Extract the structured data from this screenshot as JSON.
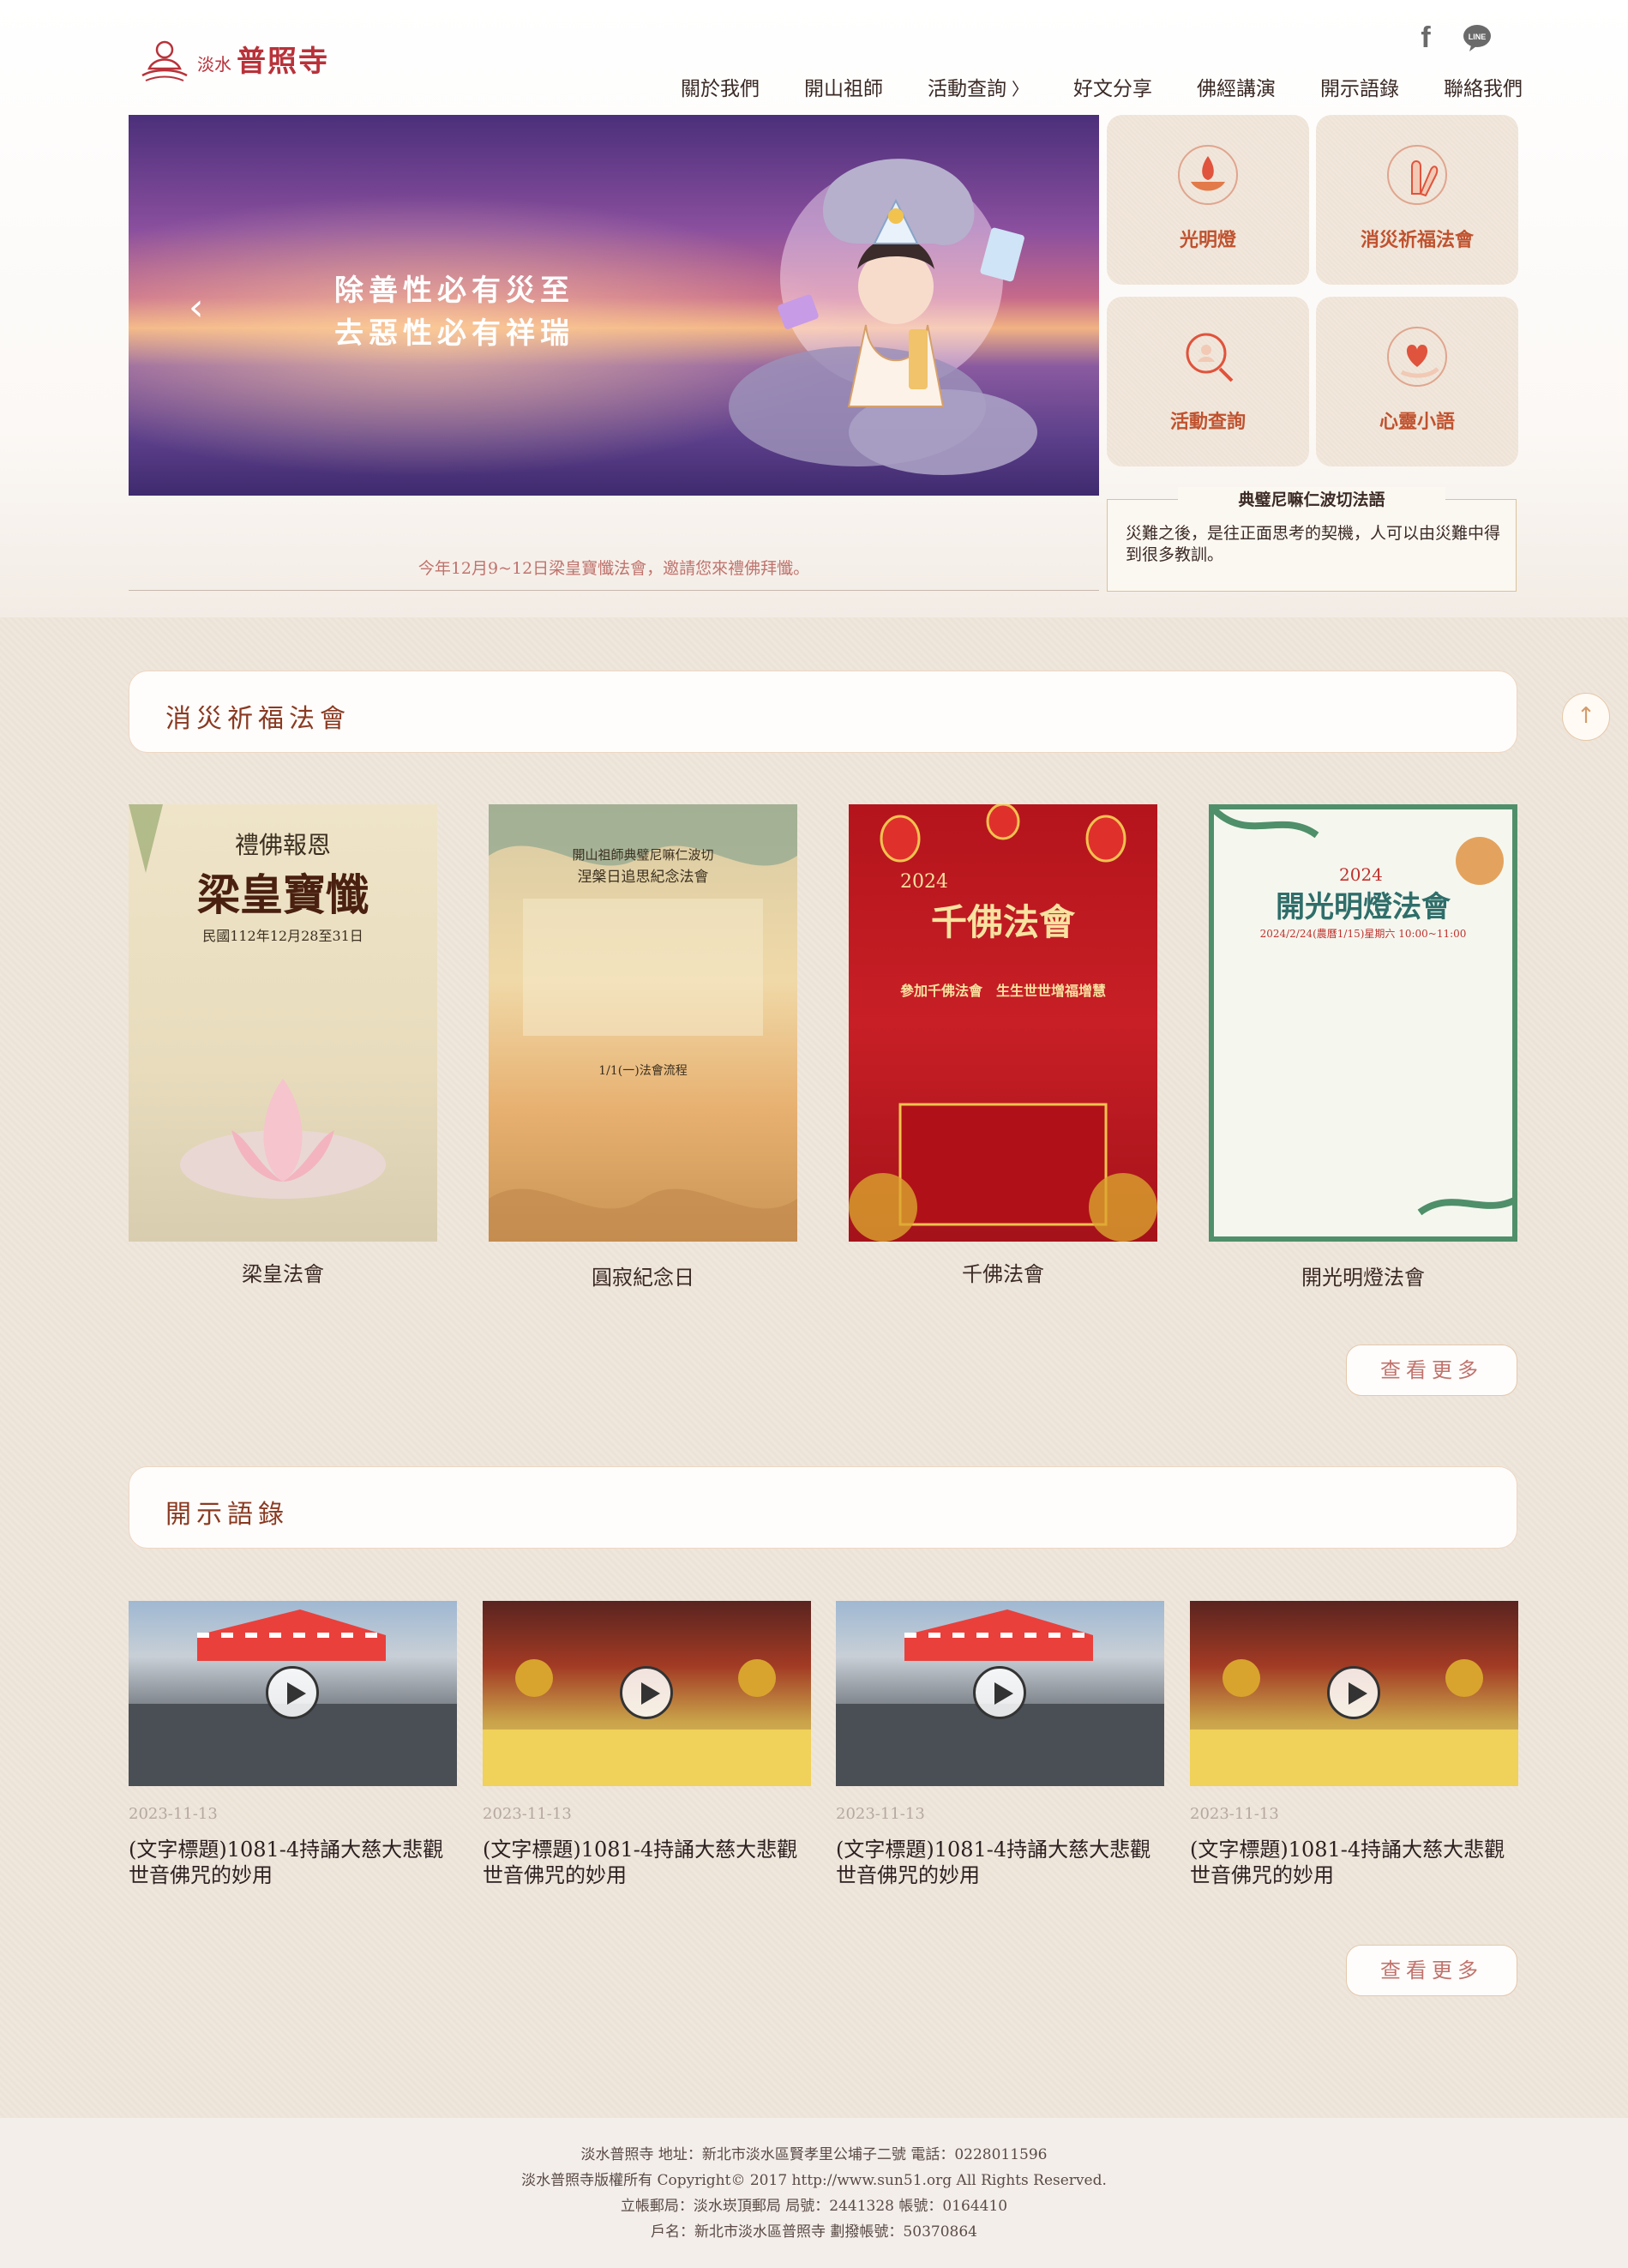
{
  "header": {
    "logo_small": "淡水",
    "logo_big": "普照寺",
    "nav": [
      "關於我們",
      "開山祖師",
      "活動查詢",
      "好文分享",
      "佛經講演",
      "開示語錄",
      "聯絡我們"
    ],
    "nav_chevron": "〉",
    "facebook_glyph": "f",
    "line_label": "LINE"
  },
  "banner": {
    "line1": "除善性必有災至",
    "line2": "去惡性必有祥瑞",
    "prev_glyph": "‹",
    "caption": "今年12月9~12日梁皇寶懺法會，邀請您來禮佛拜懺。"
  },
  "tiles": [
    "光明燈",
    "消災祈福法會",
    "活動查詢",
    "心靈小語"
  ],
  "quote": {
    "title": "典璧尼嘛仁波切法語",
    "text": "災難之後，是往正面思考的契機，人可以由災難中得到很多教訓。"
  },
  "section1": {
    "title": "消災祈福法會",
    "posters": [
      {
        "label": "梁皇法會",
        "head": "禮佛報恩",
        "title": "梁皇寶懺",
        "sub": "民國112年12月28至31日"
      },
      {
        "label": "圓寂紀念日",
        "head": "開山祖師典璧尼嘛仁波切",
        "title": "涅槃日追思紀念法會",
        "sub": "1/1(一)法會流程"
      },
      {
        "label": "千佛法會",
        "head": "2024",
        "title": "千佛法會",
        "sub": "參加千佛法會　生生世世增福增慧"
      },
      {
        "label": "開光明燈法會",
        "head": "2024",
        "title": "開光明燈法會",
        "sub": "2024/2/24(農曆1/15)星期六 10:00~11:00"
      }
    ],
    "more": "查看更多"
  },
  "section2": {
    "title": "開示語錄",
    "videos": [
      {
        "date": "2023-11-13",
        "title": "(文字標題)1081-4持誦大慈大悲觀世音佛咒的妙用"
      },
      {
        "date": "2023-11-13",
        "title": "(文字標題)1081-4持誦大慈大悲觀世音佛咒的妙用"
      },
      {
        "date": "2023-11-13",
        "title": "(文字標題)1081-4持誦大慈大悲觀世音佛咒的妙用"
      },
      {
        "date": "2023-11-13",
        "title": "(文字標題)1081-4持誦大慈大悲觀世音佛咒的妙用"
      }
    ],
    "more": "查看更多"
  },
  "up_glyph": "↑",
  "footer": {
    "line1": "淡水普照寺 地址：新北市淡水區賢孝里公埔子二號 電話：0228011596",
    "line2": "淡水普照寺版權所有 Copyright© 2017 http://www.sun51.org All Rights Reserved.",
    "line3": "立帳郵局：淡水崁頂郵局 局號：2441328 帳號：0164410",
    "line4": "戶名：新北市淡水區普照寺 劃撥帳號：50370864"
  },
  "colors": {
    "brand_red": "#b8323a",
    "tile_label": "#c0522f",
    "section_title": "#8a3a22",
    "more_text": "#c0736d"
  }
}
